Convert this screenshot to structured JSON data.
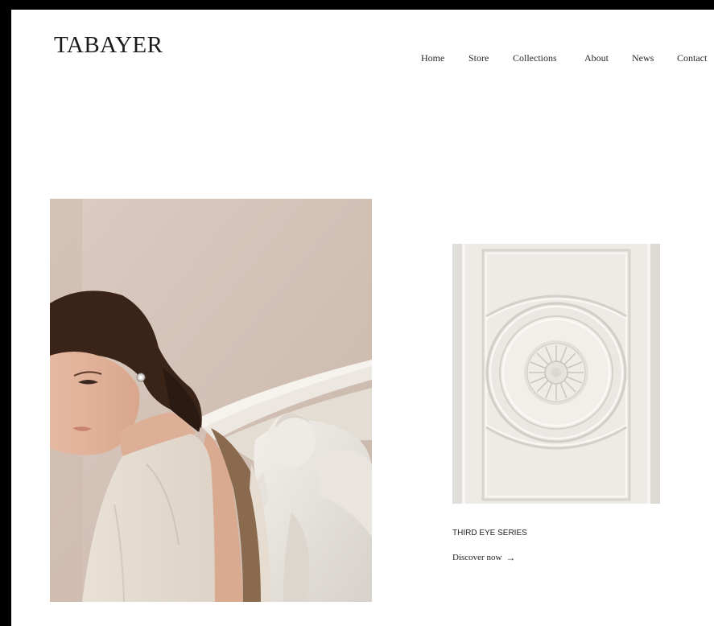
{
  "brand": {
    "logo_text": "TABAYER"
  },
  "nav": {
    "items": [
      {
        "label": "Home"
      },
      {
        "label": "Store"
      },
      {
        "label": "Collections"
      },
      {
        "label": "About"
      },
      {
        "label": "News"
      },
      {
        "label": "Contact"
      }
    ]
  },
  "feature": {
    "series_title": "THIRD EYE SERIES",
    "cta_label": "Discover now",
    "cta_icon": "arrow-right-icon"
  },
  "colors": {
    "page_background": "#ffffff",
    "frame": "#000000",
    "text": "#1a1a1a"
  }
}
